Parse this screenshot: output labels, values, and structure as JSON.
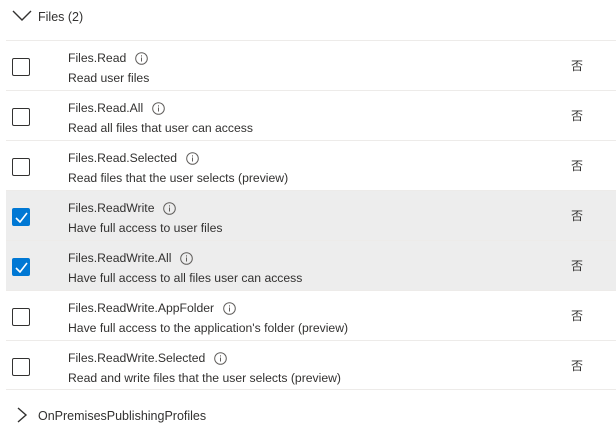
{
  "group": {
    "title": "Files (2)",
    "expanded": true
  },
  "permissions": [
    {
      "name": "Files.Read",
      "description": "Read user files",
      "admin_consent": "否",
      "checked": false
    },
    {
      "name": "Files.Read.All",
      "description": "Read all files that user can access",
      "admin_consent": "否",
      "checked": false
    },
    {
      "name": "Files.Read.Selected",
      "description": "Read files that the user selects (preview)",
      "admin_consent": "否",
      "checked": false
    },
    {
      "name": "Files.ReadWrite",
      "description": "Have full access to user files",
      "admin_consent": "否",
      "checked": true
    },
    {
      "name": "Files.ReadWrite.All",
      "description": "Have full access to all files user can access",
      "admin_consent": "否",
      "checked": true
    },
    {
      "name": "Files.ReadWrite.AppFolder",
      "description": "Have full access to the application's folder (preview)",
      "admin_consent": "否",
      "checked": false
    },
    {
      "name": "Files.ReadWrite.Selected",
      "description": "Read and write files that the user selects (preview)",
      "admin_consent": "否",
      "checked": false
    }
  ],
  "next_group": {
    "title": "OnPremisesPublishingProfiles",
    "expanded": false
  },
  "colors": {
    "checkbox_checked": "#0078d4",
    "row_selected": "#ededed",
    "divider": "#edebe9",
    "text": "#323130"
  },
  "icons": {
    "expand": "chevron-down-icon",
    "collapse": "chevron-right-icon",
    "info": "info-icon",
    "check": "checkmark-icon"
  }
}
